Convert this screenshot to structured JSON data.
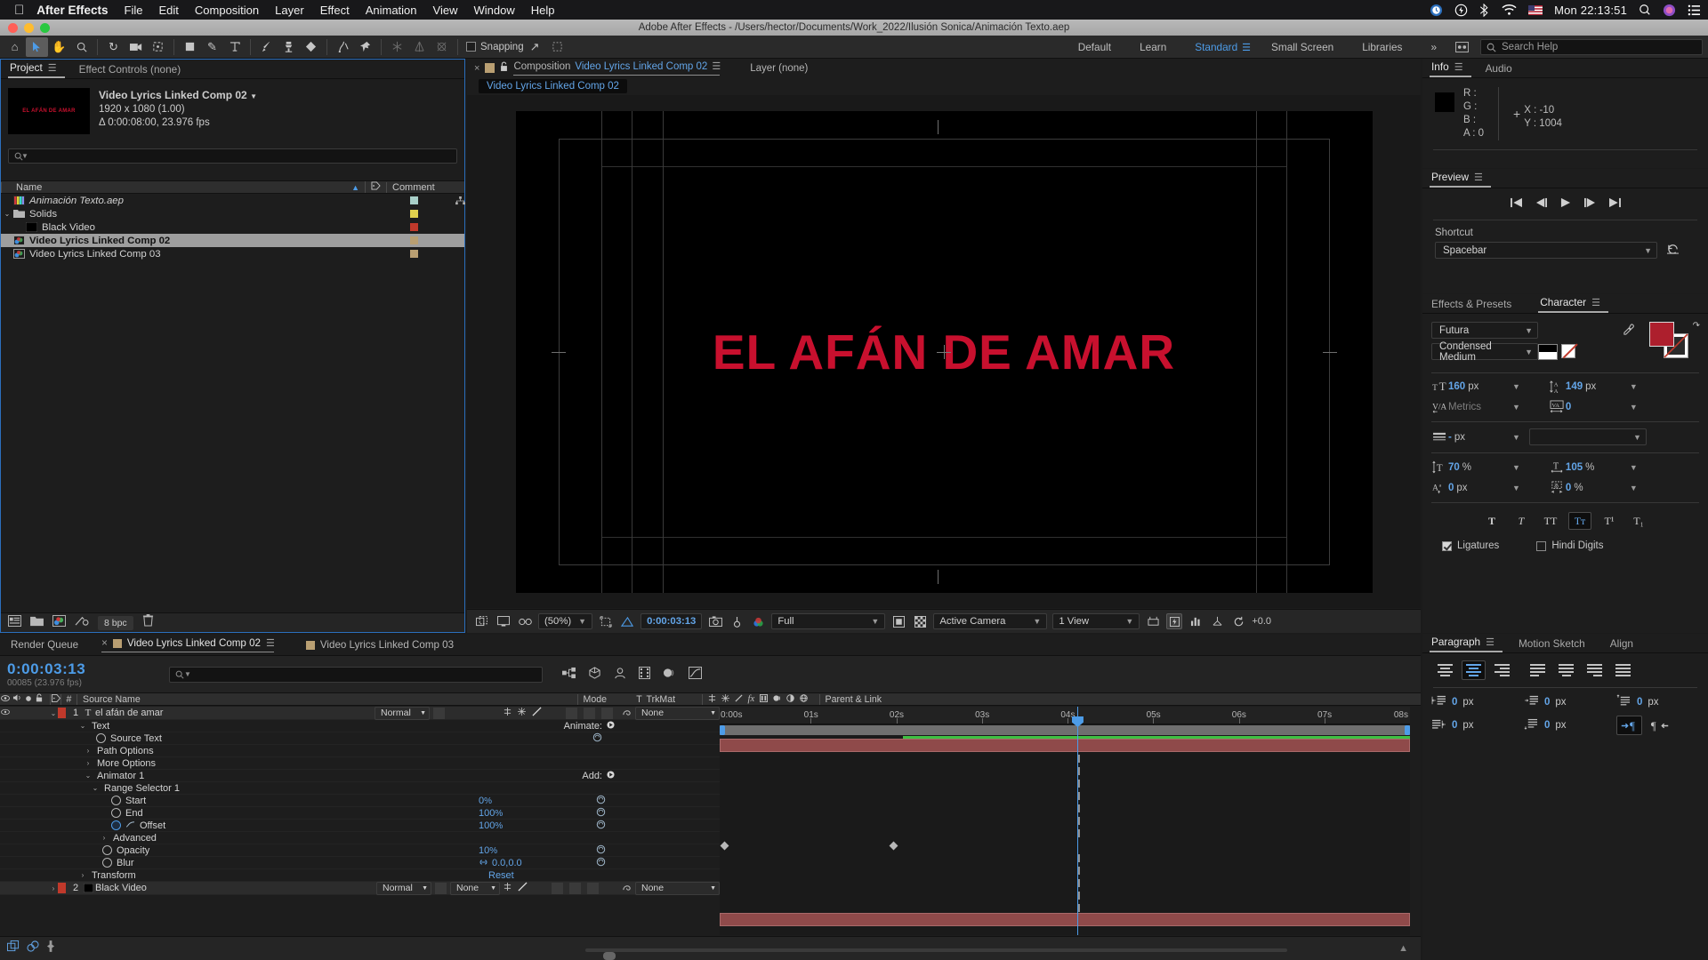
{
  "macos": {
    "app_name": "After Effects",
    "menus": [
      "File",
      "Edit",
      "Composition",
      "Layer",
      "Effect",
      "Animation",
      "View",
      "Window",
      "Help"
    ],
    "clock": "Mon 22:13:51",
    "tray_icons": [
      "timemachine-icon",
      "power-icon",
      "bluetooth-icon",
      "wifi-icon",
      "flag-icon",
      "search-icon",
      "siri-icon",
      "controlcenter-icon"
    ]
  },
  "window": {
    "title": "Adobe After Effects - /Users/hector/Documents/Work_2022/Ilusión Sonica/Animación Texto.aep"
  },
  "toolbar": {
    "tools": [
      "home-icon",
      "selection-icon",
      "hand-icon",
      "zoom-icon",
      "rotation-icon",
      "camera-icon",
      "anchor-point-icon",
      "rectangle-icon",
      "pen-icon",
      "type-icon",
      "brush-icon",
      "clone-stamp-icon",
      "eraser-icon",
      "roto-brush-icon",
      "puppet-pin-icon"
    ],
    "dim_tools": [
      "unified-camera-icon",
      "orbit-icon",
      "pan-behind-icon"
    ],
    "snapping_label": "Snapping",
    "snapping_checked": false,
    "workspaces": [
      "Default",
      "Learn",
      "Standard",
      "Small Screen",
      "Libraries"
    ],
    "workspace_active": "Standard",
    "overflow_label": "»",
    "search_help_placeholder": "Search Help"
  },
  "project_panel": {
    "tabs": [
      {
        "label": "Project",
        "active": true
      },
      {
        "label": "Effect Controls (none)",
        "active": false
      }
    ],
    "selected_item": {
      "name": "Video Lyrics  Linked Comp 02",
      "dimensions": "1920 x 1080 (1.00)",
      "duration": "Δ 0:00:08:00, 23.976 fps",
      "thumb_text": "EL AFÁN DE AMAR"
    },
    "search_placeholder": "",
    "columns": [
      "Name",
      "Comment"
    ],
    "items": [
      {
        "name": "Animación Texto.aep",
        "indent": 0,
        "twisty": "",
        "icon": "aep-file-icon",
        "color": "#a8cfc8",
        "italic": true,
        "selected": false,
        "has_link": true
      },
      {
        "name": "Solids",
        "indent": 0,
        "twisty": "⌄",
        "icon": "folder-icon",
        "color": "#e0d14e",
        "italic": false,
        "selected": false,
        "has_link": false
      },
      {
        "name": "Black Video",
        "indent": 1,
        "twisty": "",
        "icon": "solid-icon",
        "color": "#c0392b",
        "italic": false,
        "selected": false,
        "has_link": false
      },
      {
        "name": "Video Lyrics  Linked Comp 02",
        "indent": 0,
        "twisty": "",
        "icon": "comp-icon",
        "color": "#b99f72",
        "italic": false,
        "selected": true,
        "has_link": false
      },
      {
        "name": "Video Lyrics  Linked Comp 03",
        "indent": 0,
        "twisty": "",
        "icon": "comp-icon",
        "color": "#b99f72",
        "italic": false,
        "selected": false,
        "has_link": false
      }
    ],
    "footer": {
      "bit_depth": "8 bpc",
      "icons": [
        "interpret-footage-icon",
        "new-folder-icon",
        "new-composition-icon",
        "project-settings-icon",
        "delete-icon"
      ]
    }
  },
  "comp_panel": {
    "tab_prefix": "Composition",
    "tab_name": "Video Lyrics  Linked Comp 02",
    "layer_tab": "Layer (none)",
    "breadcrumb": "Video Lyrics  Linked Comp 02",
    "stage_text": "EL AFÁN DE AMAR",
    "stage_text_color": "#c8102e",
    "footer": {
      "zoom": "(50%)",
      "timecode": "0:00:03:13",
      "resolution": "Full",
      "camera": "Active Camera",
      "views": "1 View",
      "exposure": "+0.0",
      "icons": [
        "toggle-mask-icon",
        "toggle-transparency-icon",
        "toggle-3d-glasses-icon",
        "region-of-interest-icon",
        "toggle-rulers-icon",
        "snapshot-icon",
        "show-snapshot-icon",
        "channel-icon",
        "toggle-alpha-icon",
        "transparency-grid-icon",
        "timeline-graph-icon",
        "3d-ground-plane-icon",
        "reset-exposure-icon"
      ]
    }
  },
  "info_panel": {
    "tabs": [
      {
        "label": "Info",
        "active": true
      },
      {
        "label": "Audio",
        "active": false
      }
    ],
    "channels": [
      {
        "key": "R :",
        "value": ""
      },
      {
        "key": "G :",
        "value": ""
      },
      {
        "key": "B :",
        "value": ""
      },
      {
        "key": "A :",
        "value": "0"
      }
    ],
    "coords": [
      {
        "key": "X :",
        "value": "-10"
      },
      {
        "key": "Y :",
        "value": "1004"
      }
    ],
    "swatch_color": "#000000"
  },
  "preview_panel": {
    "tab": "Preview",
    "transport": [
      "first-frame-icon",
      "previous-frame-icon",
      "play-icon",
      "next-frame-icon",
      "last-frame-icon"
    ],
    "shortcut_label": "Shortcut",
    "shortcut_value": "Spacebar",
    "reset_icon": "reset-icon"
  },
  "character_panel": {
    "tabs": [
      {
        "label": "Effects & Presets",
        "active": false
      },
      {
        "label": "Character",
        "active": true
      }
    ],
    "font_family": "Futura",
    "font_style": "Condensed Medium",
    "fill_color": "#ad1f2d",
    "font_size": {
      "value": "160",
      "unit": "px",
      "icon": "font-size-icon"
    },
    "leading": {
      "value": "149",
      "unit": "px",
      "icon": "leading-icon"
    },
    "kerning": {
      "value": "Metrics",
      "unit": "",
      "icon": "kerning-icon"
    },
    "tracking": {
      "value": "0",
      "unit": "",
      "icon": "tracking-icon"
    },
    "stroke_width": {
      "value": "-",
      "unit": "px",
      "icon": "stroke-width-icon"
    },
    "stroke_type": "",
    "vertical_scale": {
      "value": "70",
      "unit": "%",
      "icon": "vertical-scale-icon"
    },
    "horizontal_scale": {
      "value": "105",
      "unit": "%",
      "icon": "horizontal-scale-icon"
    },
    "baseline_shift": {
      "value": "0",
      "unit": "px",
      "icon": "baseline-shift-icon"
    },
    "tsume": {
      "value": "0",
      "unit": "%",
      "icon": "tsume-icon"
    },
    "style_buttons": [
      {
        "name": "faux-bold",
        "glyph": "T",
        "active": false,
        "style": "bold"
      },
      {
        "name": "faux-italic",
        "glyph": "T",
        "active": false,
        "style": "italic"
      },
      {
        "name": "all-caps",
        "glyph": "TT",
        "active": false,
        "style": ""
      },
      {
        "name": "small-caps",
        "glyph": "Tт",
        "active": true,
        "style": ""
      },
      {
        "name": "superscript",
        "glyph": "T¹",
        "active": false,
        "style": ""
      },
      {
        "name": "subscript",
        "glyph": "T₁",
        "active": false,
        "style": ""
      }
    ],
    "ligatures_label": "Ligatures",
    "ligatures_checked": true,
    "hindi_label": "Hindi Digits",
    "hindi_checked": false
  },
  "paragraph_panel": {
    "tabs": [
      {
        "label": "Paragraph",
        "active": true
      },
      {
        "label": "Motion Sketch",
        "active": false
      },
      {
        "label": "Align",
        "active": false
      }
    ],
    "align_buttons": [
      "align-left",
      "align-center",
      "align-right",
      "justify-last-left",
      "justify-last-center",
      "justify-last-right",
      "justify-all"
    ],
    "align_active_index": 1,
    "indents": [
      {
        "name": "indent-left",
        "value": "0",
        "unit": "px"
      },
      {
        "name": "indent-right",
        "value": "0",
        "unit": "px"
      },
      {
        "name": "space-before",
        "value": "0",
        "unit": "px"
      },
      {
        "name": "first-line-indent",
        "value": "0",
        "unit": "px"
      },
      {
        "name": "space-after",
        "value": "0",
        "unit": "px"
      }
    ],
    "direction_buttons": [
      "ltr-direction",
      "rtl-direction"
    ],
    "direction_active_index": 0
  },
  "timeline": {
    "tabs": [
      {
        "label": "Render Queue",
        "active": false,
        "has_swatch": false,
        "closable": false
      },
      {
        "label": "Video Lyrics  Linked Comp 02",
        "active": true,
        "has_swatch": true,
        "closable": true
      },
      {
        "label": "Video Lyrics  Linked Comp 03",
        "active": false,
        "has_swatch": true,
        "closable": false
      }
    ],
    "current_time": "0:00:03:13",
    "current_frame": "00085 (23.976 fps)",
    "search_placeholder": "",
    "header_icons": [
      "composition-mini-flowchart-icon",
      "draft-3d-icon",
      "hide-shy-layers-icon",
      "frame-blending-icon",
      "motion-blur-icon",
      "graph-editor-icon"
    ],
    "columns": [
      "Source Name",
      "Mode",
      "T",
      "TrkMat",
      "Parent & Link"
    ],
    "column_switch_icons": [
      "video-icon",
      "audio-icon",
      "solo-icon",
      "lock-icon",
      "label-icon",
      "index-icon"
    ],
    "switch_icons": [
      "shy-icon",
      "collapse-transform-icon",
      "quality-icon",
      "effects-icon",
      "frame-blend-icon",
      "motion-blur-icon",
      "adjustment-layer-icon",
      "3d-layer-icon"
    ],
    "ruler_labels": [
      "0:00s",
      "01s",
      "02s",
      "03s",
      "04s",
      "05s",
      "06s",
      "07s",
      "08s"
    ],
    "layers": [
      {
        "index": "1",
        "name": "el afán de amar",
        "type_icon": "text-layer-icon",
        "label_color": "#c0392b",
        "mode": "Normal",
        "trkmat": "",
        "parent": "None",
        "bar_color": "#8f4a4a",
        "expanded": true
      },
      {
        "index": "2",
        "name": "Black Video",
        "type_icon": "solid-layer-icon",
        "label_color": "#c0392b",
        "mode": "Normal",
        "trkmat": "None",
        "parent": "None",
        "bar_color": "#8f4a4a",
        "expanded": false
      }
    ],
    "properties": [
      {
        "label": "Text",
        "indent": 1,
        "twisty": "⌄",
        "stopwatch": "none",
        "value": "",
        "unit": "",
        "right_label": "Animate:",
        "keyframable": false
      },
      {
        "label": "Source Text",
        "indent": 2,
        "twisty": "",
        "stopwatch": "off",
        "value": "",
        "unit": "",
        "right_label": "",
        "keyframable": true
      },
      {
        "label": "Path Options",
        "indent": 2,
        "twisty": "›",
        "stopwatch": "none",
        "value": "",
        "unit": "",
        "right_label": "",
        "keyframable": false
      },
      {
        "label": "More Options",
        "indent": 2,
        "twisty": "›",
        "stopwatch": "none",
        "value": "",
        "unit": "",
        "right_label": "",
        "keyframable": false
      },
      {
        "label": "Animator 1",
        "indent": 2,
        "twisty": "⌄",
        "stopwatch": "none",
        "value": "",
        "unit": "",
        "right_label": "Add:",
        "keyframable": false
      },
      {
        "label": "Range Selector 1",
        "indent": 3,
        "twisty": "⌄",
        "stopwatch": "none",
        "value": "",
        "unit": "",
        "right_label": "",
        "keyframable": false
      },
      {
        "label": "Start",
        "indent": 4,
        "twisty": "",
        "stopwatch": "off",
        "value": "0",
        "unit": "%",
        "right_label": "",
        "keyframable": true
      },
      {
        "label": "End",
        "indent": 4,
        "twisty": "",
        "stopwatch": "off",
        "value": "100",
        "unit": "%",
        "right_label": "",
        "keyframable": true
      },
      {
        "label": "Offset",
        "indent": 4,
        "twisty": "",
        "stopwatch": "on",
        "value": "100",
        "unit": "%",
        "right_label": "",
        "keyframable": true,
        "has_graph": true
      },
      {
        "label": "Advanced",
        "indent": 4,
        "twisty": "›",
        "stopwatch": "none",
        "value": "",
        "unit": "",
        "right_label": "",
        "keyframable": false
      },
      {
        "label": "Opacity",
        "indent": 3,
        "twisty": "",
        "stopwatch": "off",
        "value": "10",
        "unit": "%",
        "right_label": "",
        "keyframable": true
      },
      {
        "label": "Blur",
        "indent": 3,
        "twisty": "",
        "stopwatch": "off",
        "value": "0.0,0.0",
        "unit": "",
        "right_label": "",
        "keyframable": true,
        "linked": true
      },
      {
        "label": "Transform",
        "indent": 1,
        "twisty": "›",
        "stopwatch": "none",
        "value": "",
        "unit": "",
        "right_label": "Reset",
        "keyframable": false
      }
    ],
    "keyframes": [
      {
        "property": "Offset",
        "times": [
          "0:00s",
          "02s"
        ],
        "positions_pct": [
          0.3,
          24.8
        ]
      }
    ],
    "footer_icons": [
      "toggle-switches-modes-icon",
      "comp-button-icon",
      "pixel-motion-icon"
    ]
  }
}
